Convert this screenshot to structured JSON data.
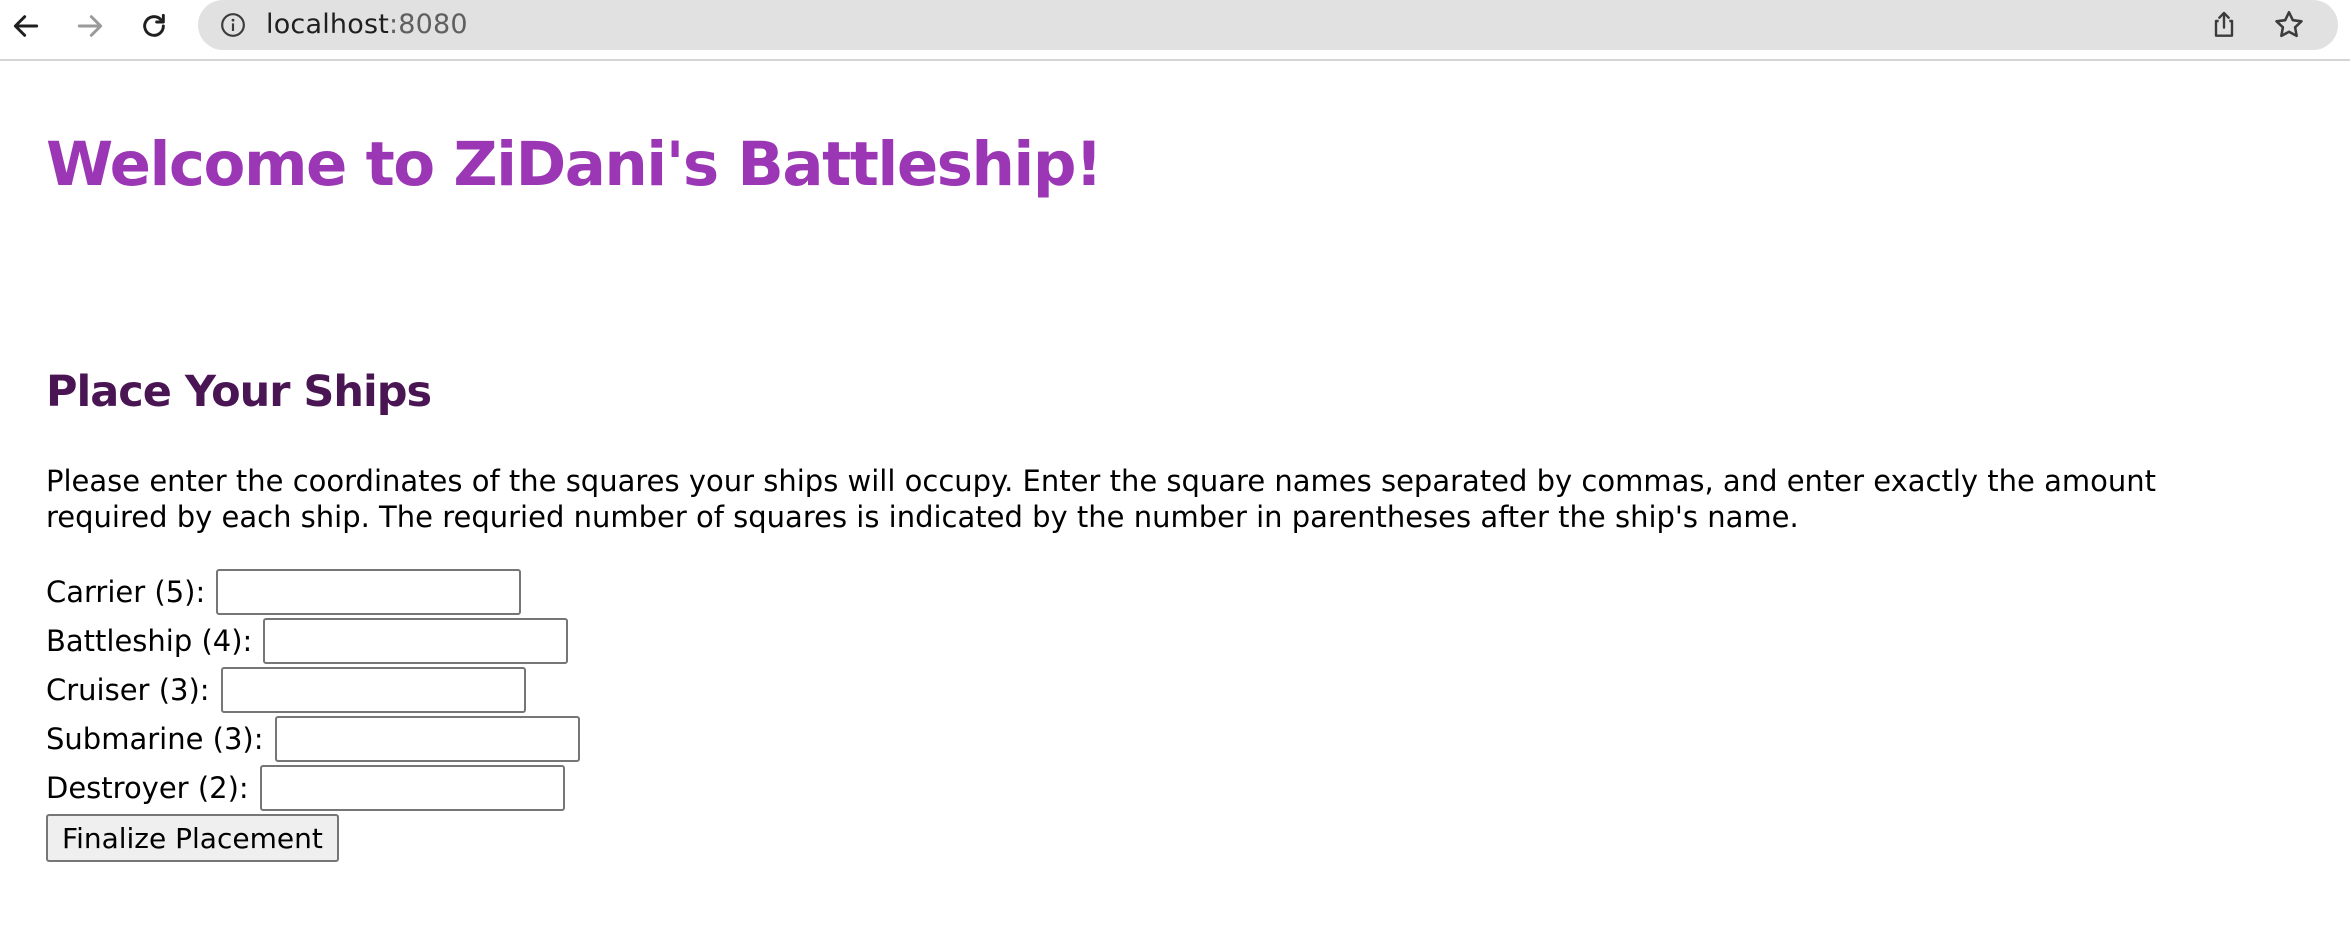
{
  "browser": {
    "url_host": "localhost",
    "url_port": ":8080",
    "icons": [
      "back-arrow-icon",
      "forward-arrow-icon",
      "reload-icon",
      "info-icon",
      "share-icon",
      "star-icon"
    ]
  },
  "page": {
    "title": "Welcome to ZiDani's Battleship!",
    "section_heading": "Place Your Ships",
    "instructions": "Please enter the coordinates of the squares your ships will occupy. Enter the square names separated by commas, and enter exactly the amount required by each ship. The requried number of squares is indicated by the number in parentheses after the ship's name.",
    "ships": [
      {
        "label": "Carrier (5):",
        "value": ""
      },
      {
        "label": "Battleship (4):",
        "value": ""
      },
      {
        "label": "Cruiser (3):",
        "value": ""
      },
      {
        "label": "Submarine (3):",
        "value": ""
      },
      {
        "label": "Destroyer (2):",
        "value": ""
      }
    ],
    "submit_label": "Finalize Placement"
  },
  "colors": {
    "title": "#9b37b5",
    "heading": "#4a1553",
    "omnibox": "#e1e1e1"
  }
}
